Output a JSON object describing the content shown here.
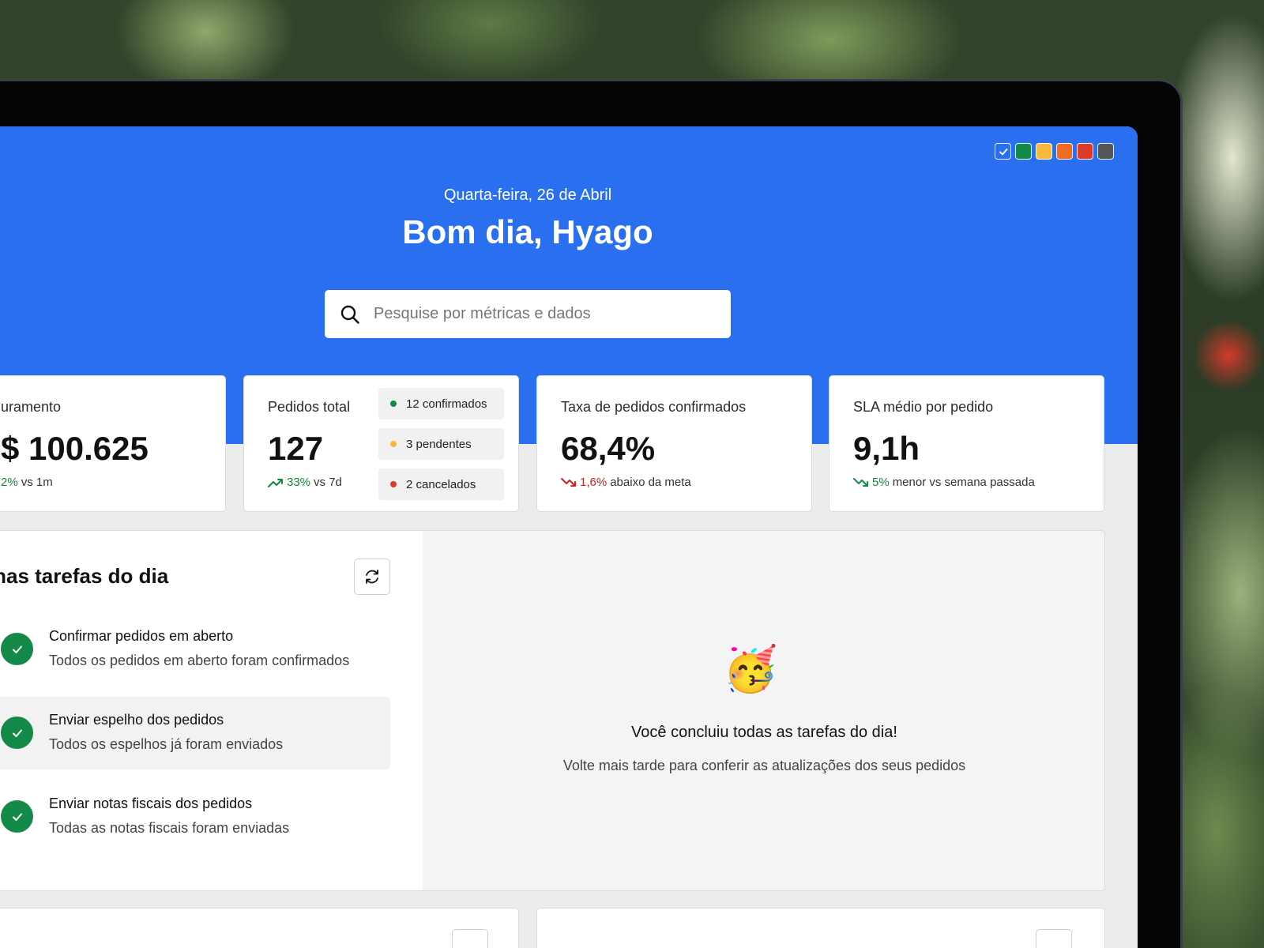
{
  "header": {
    "date": "Quarta-feira, 26 de Abril",
    "greeting": "Bom dia, Hyago"
  },
  "theme_swatches": [
    {
      "name": "blue",
      "color": "#2a6ff0",
      "selected": true
    },
    {
      "name": "green",
      "color": "#138a47"
    },
    {
      "name": "yellow",
      "color": "#f6b93b"
    },
    {
      "name": "orange",
      "color": "#f06a25"
    },
    {
      "name": "red",
      "color": "#dd3a2a"
    },
    {
      "name": "gray",
      "color": "#555555"
    }
  ],
  "search": {
    "placeholder": "Pesquise por métricas e dados"
  },
  "metrics": [
    {
      "label": "uramento",
      "value": "$ 100.625",
      "delta_value": "2%",
      "delta_text": "vs 1m",
      "trend": "up"
    },
    {
      "label": "Pedidos total",
      "value": "127",
      "delta_value": "33%",
      "delta_text": "vs 7d",
      "trend": "up"
    },
    {
      "label": "Taxa de pedidos confirmados",
      "value": "68,4%",
      "delta_value": "1,6%",
      "delta_text": "abaixo da meta",
      "trend": "down"
    },
    {
      "label": "SLA médio por pedido",
      "value": "9,1h",
      "delta_value": "5%",
      "delta_text": "menor vs semana passada",
      "trend": "down-good"
    }
  ],
  "order_status": [
    {
      "count": "12",
      "label": "confirmados",
      "color": "#138a47"
    },
    {
      "count": "3",
      "label": "pendentes",
      "color": "#f6b93b"
    },
    {
      "count": "2",
      "label": "cancelados",
      "color": "#dd3a2a"
    }
  ],
  "tasks": {
    "title": "inhas tarefas do dia",
    "items": [
      {
        "title": "Confirmar pedidos em aberto",
        "subtitle": "Todos os pedidos em aberto foram confirmados"
      },
      {
        "title": "Enviar espelho dos pedidos",
        "subtitle": "Todos os espelhos já foram enviados"
      },
      {
        "title": "Enviar notas fiscais dos pedidos",
        "subtitle": "Todas as notas fiscais foram enviadas"
      }
    ]
  },
  "empty_state": {
    "emoji": "🥳",
    "title": "Você concluiu todas as tarefas do dia!",
    "subtitle": "Volte mais tarde para conferir as atualizações dos seus pedidos"
  }
}
